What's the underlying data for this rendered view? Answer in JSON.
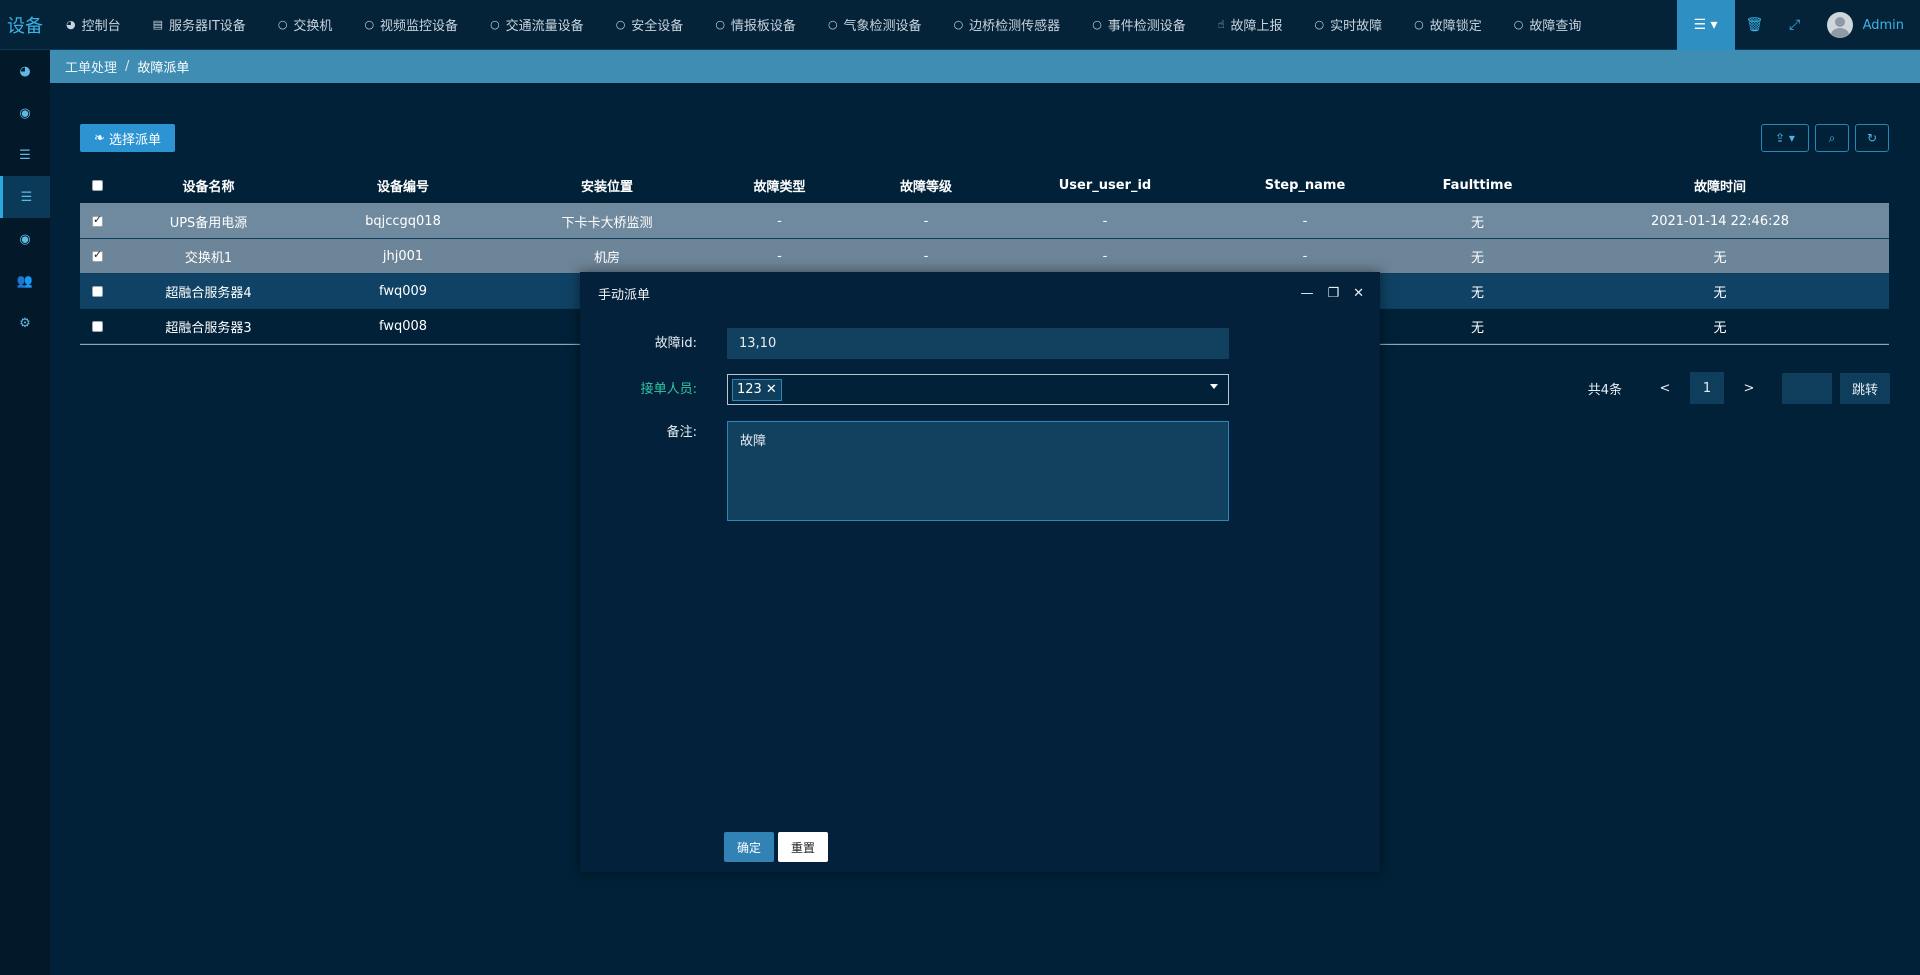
{
  "brand": "设备",
  "nav": {
    "items": [
      {
        "label": "控制台",
        "icon": "dashboard-icon"
      },
      {
        "label": "服务器IT设备",
        "icon": "server-icon"
      },
      {
        "label": "交换机",
        "icon": "circle-icon"
      },
      {
        "label": "视频监控设备",
        "icon": "circle-icon"
      },
      {
        "label": "交通流量设备",
        "icon": "circle-icon"
      },
      {
        "label": "安全设备",
        "icon": "circle-icon"
      },
      {
        "label": "情报板设备",
        "icon": "circle-icon"
      },
      {
        "label": "气象检测设备",
        "icon": "circle-icon"
      },
      {
        "label": "边桥检测传感器",
        "icon": "circle-icon"
      },
      {
        "label": "事件检测设备",
        "icon": "circle-icon"
      },
      {
        "label": "故障上报",
        "icon": "hand-icon"
      },
      {
        "label": "实时故障",
        "icon": "circle-icon"
      },
      {
        "label": "故障锁定",
        "icon": "circle-icon"
      },
      {
        "label": "故障查询",
        "icon": "circle-icon"
      }
    ],
    "user": "Admin"
  },
  "breadcrumb": {
    "parent": "工单处理",
    "sep": "/",
    "current": "故障派单"
  },
  "toolbar": {
    "select_label": "选择派单"
  },
  "table": {
    "headers": [
      "设备名称",
      "设备编号",
      "安装位置",
      "故障类型",
      "故障等级",
      "User_user_id",
      "Step_name",
      "Faulttime",
      "故障时间"
    ],
    "rows": [
      {
        "checked": true,
        "cells": [
          "UPS备用电源",
          "bqjccgq018",
          "下卡卡大桥监测",
          "-",
          "-",
          "-",
          "-",
          "无",
          "2021-01-14 22:46:28"
        ]
      },
      {
        "checked": true,
        "cells": [
          "交换机1",
          "jhj001",
          "机房",
          "-",
          "-",
          "-",
          "-",
          "无",
          "无"
        ]
      },
      {
        "checked": false,
        "cells": [
          "超融合服务器4",
          "fwq009",
          "",
          "",
          "",
          "",
          "",
          "无",
          "无"
        ]
      },
      {
        "checked": false,
        "cells": [
          "超融合服务器3",
          "fwq008",
          "",
          "",
          "",
          "",
          "",
          "无",
          "无"
        ]
      }
    ]
  },
  "pager": {
    "total": "共4条",
    "prev": "<",
    "current": "1",
    "next": ">",
    "go": "跳转"
  },
  "modal": {
    "title": "手动派单",
    "fault_id_label": "故障id:",
    "fault_id_value": "13,10",
    "assignee_label": "接单人员:",
    "assignee_tag": "123",
    "remark_label": "备注:",
    "remark_value": "故障",
    "ok_label": "确定",
    "reset_label": "重置"
  },
  "colors": {
    "accent": "#2c94d3",
    "breadcrumb_bg": "#3f8db3",
    "page_bg": "#002138",
    "label_accent": "#2fc7a3"
  }
}
